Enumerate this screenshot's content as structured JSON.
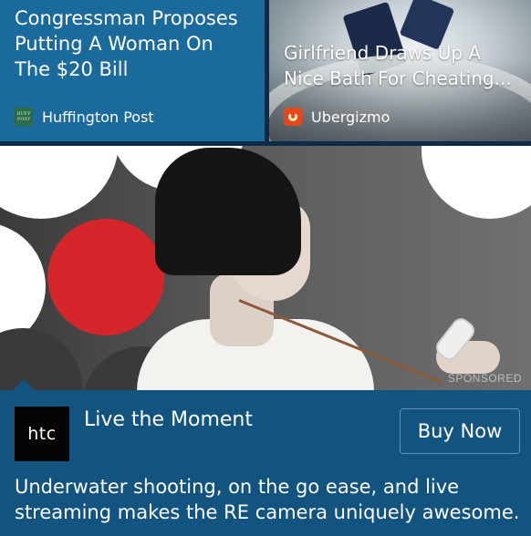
{
  "news": [
    {
      "title": "Congressman Proposes Putting A Woman On The $20 Bill",
      "source": "Huffington Post",
      "source_logo": "huffpost-logo",
      "source_logo_text": "HUFF POST"
    },
    {
      "title": "Girlfriend Draws Up A Nice Bath For Cheating...",
      "source": "Ubergizmo",
      "source_logo": "ubergizmo-logo"
    }
  ],
  "ad": {
    "sponsored_label": "SPONSORED",
    "brand_logo_text": "htc",
    "headline": "Live the Moment",
    "cta_label": "Buy Now",
    "description": "Underwater shooting, on the go ease, and live streaming makes the RE camera uniquely awesome."
  },
  "colors": {
    "left_card": "#1a6a9c",
    "ad_footer": "#12547f",
    "divider": "#0c2b44",
    "accent_red": "#d4262a"
  }
}
